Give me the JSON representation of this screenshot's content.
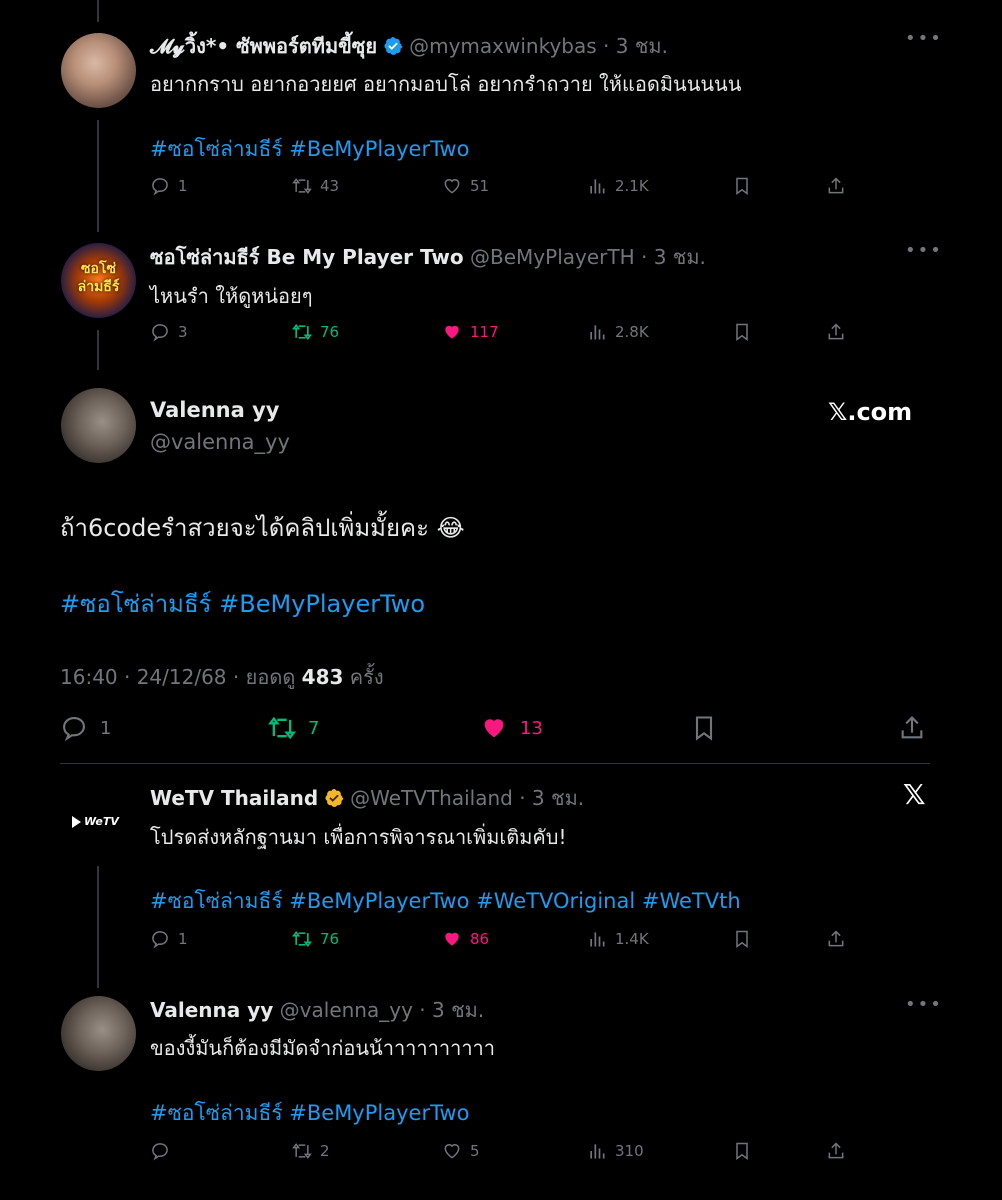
{
  "tweet1": {
    "author_name": "𝓜𝔂วิ้ง*• ซัพพอร์ตทีมขี้ซุย",
    "handle": "@mymaxwinkybas",
    "time": "3 ชม.",
    "text": "อยากกราบ อยากอวยยศ อยากมอบโล่ อยากรำถวาย ให้แอดมินนนนน",
    "hashtags": "#ซอโซ่ล่ามธีร์ #BeMyPlayerTwo",
    "replies": "1",
    "retweets": "43",
    "likes": "51",
    "views": "2.1K"
  },
  "tweet2": {
    "author_name": "ซอโซ่ล่ามธีร์ Be My Player Two",
    "handle": "@BeMyPlayerTH",
    "time": "3 ชม.",
    "text": "ไหนรำ ให้ดูหน่อยๆ",
    "avatar_text_top": "ซอโซ่",
    "avatar_text_bottom": "ล่ามธีร์",
    "replies": "3",
    "retweets": "76",
    "likes": "117",
    "views": "2.8K"
  },
  "main_tweet": {
    "author_name": "Valenna yy",
    "handle": "@valenna_yy",
    "brand": "𝕏.com",
    "text": "ถ้า6codeรำสวยจะได้คลิปเพิ่มมั้ยคะ 😂",
    "hashtags": "#ซอโซ่ล่ามธีร์ #BeMyPlayerTwo",
    "timestamp": "16:40 · 24/12/68 · ยอดดู",
    "views": "483",
    "views_suffix": "ครั้ง",
    "replies": "1",
    "retweets": "7",
    "likes": "13"
  },
  "tweet3": {
    "author_name": "WeTV Thailand",
    "handle": "@WeTVThailand",
    "time": "3 ชม.",
    "avatar_label": "WeTV",
    "text": "โปรดส่งหลักฐานมา เพื่อการพิจารณาเพิ่มเติมคับ!",
    "hashtags": "#ซอโซ่ล่ามธีร์ #BeMyPlayerTwo #WeTVOriginal #WeTVth",
    "replies": "1",
    "retweets": "76",
    "likes": "86",
    "views": "1.4K"
  },
  "tweet4": {
    "author_name": "Valenna yy",
    "handle": "@valenna_yy",
    "time": "3 ชม.",
    "text": "ของงี้มันก็ต้องมีมัดจำก่อนน้าาาาาาาาาา",
    "hashtags": "#ซอโซ่ล่ามธีร์ #BeMyPlayerTwo",
    "replies": "",
    "retweets": "2",
    "likes": "5",
    "views": "310"
  },
  "colors": {
    "accent": "#1d9bf0",
    "like": "#f91880",
    "retweet": "#00ba7c",
    "muted": "#71767b",
    "gold": "#f4b72a"
  },
  "icons": [
    "reply-icon",
    "retweet-icon",
    "like-icon",
    "views-icon",
    "bookmark-icon",
    "share-icon",
    "more-icon",
    "verified-badge-icon",
    "x-logo-icon"
  ]
}
